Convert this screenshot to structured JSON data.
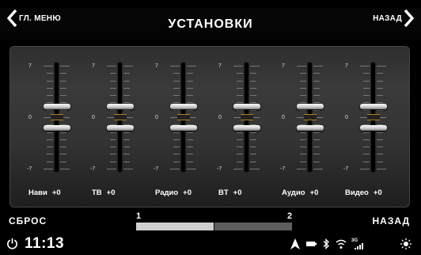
{
  "header": {
    "title": "УСТАНОВКИ",
    "left_label": "ГЛ. МЕНЮ",
    "right_label": "НАЗАД"
  },
  "scale": {
    "max": "7",
    "zero": "0",
    "min": "-7"
  },
  "channels": [
    {
      "name": "Нави",
      "value": "+0",
      "level": 0
    },
    {
      "name": "ТВ",
      "value": "+0",
      "level": 0
    },
    {
      "name": "Радио",
      "value": "+0",
      "level": 0
    },
    {
      "name": "BT",
      "value": "+0",
      "level": 0
    },
    {
      "name": "Аудио",
      "value": "+0",
      "level": 0
    },
    {
      "name": "Видео",
      "value": "+0",
      "level": 0
    }
  ],
  "footer": {
    "reset_label": "СБРОС",
    "back_label": "НАЗАД",
    "pages": [
      {
        "number": "1",
        "active": true
      },
      {
        "number": "2",
        "active": false
      }
    ]
  },
  "status": {
    "time": "11:13",
    "signal_label": "3G",
    "icons": [
      "power-icon",
      "navigation-arrow-icon",
      "battery-icon",
      "bluetooth-icon",
      "wifi-icon",
      "signal-3g-icon",
      "brightness-icon"
    ]
  },
  "colors": {
    "background": "#000000",
    "panel": "#333333",
    "active_page": "#cfcfcf",
    "inactive_page": "#5e5e5e",
    "knob_accent": "#b08020"
  }
}
